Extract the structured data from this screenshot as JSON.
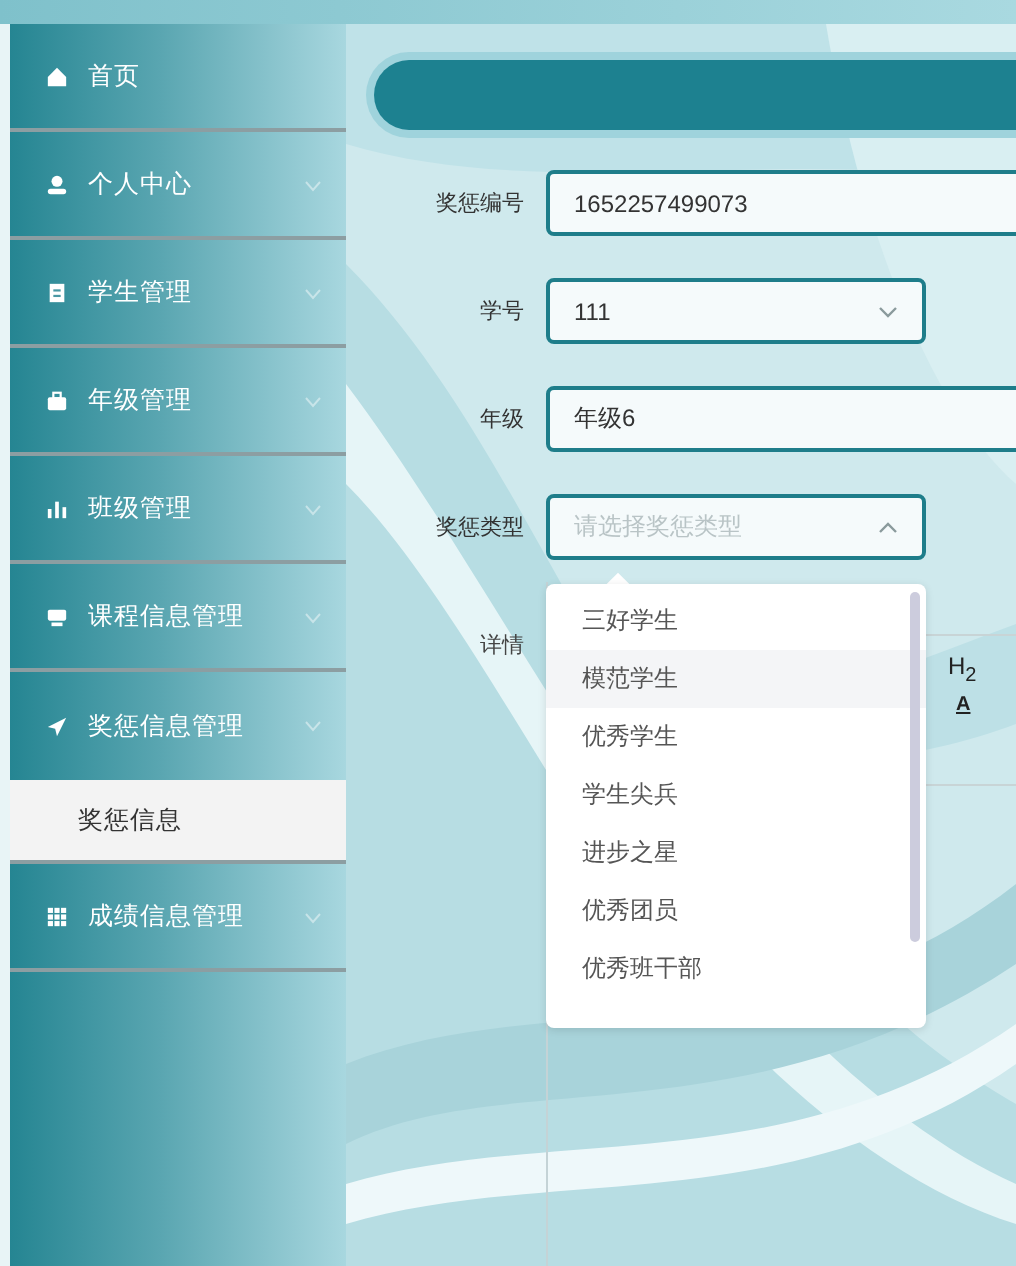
{
  "sidebar": {
    "items": [
      {
        "label": "首页"
      },
      {
        "label": "个人中心",
        "expanded": false
      },
      {
        "label": "学生管理",
        "expanded": false
      },
      {
        "label": "年级管理",
        "expanded": false
      },
      {
        "label": "班级管理",
        "expanded": false
      },
      {
        "label": "课程信息管理",
        "expanded": false
      },
      {
        "label": "奖惩信息管理",
        "expanded": true,
        "children": [
          {
            "label": "奖惩信息",
            "selected": true
          }
        ]
      },
      {
        "label": "成绩信息管理",
        "expanded": false
      }
    ]
  },
  "form": {
    "fields": [
      {
        "kind": "text",
        "label": "奖惩编号",
        "value": "1652257499073"
      },
      {
        "kind": "select",
        "label": "学号",
        "value": "111",
        "open": false
      },
      {
        "kind": "text",
        "label": "年级",
        "value": "年级6"
      },
      {
        "kind": "select",
        "label": "奖惩类型",
        "placeholder": "请选择奖惩类型",
        "open": true,
        "options": [
          {
            "label": "三好学生",
            "highlighted": false
          },
          {
            "label": "模范学生",
            "highlighted": true
          },
          {
            "label": "优秀学生",
            "highlighted": false
          },
          {
            "label": "学生尖兵",
            "highlighted": false
          },
          {
            "label": "进步之星",
            "highlighted": false
          },
          {
            "label": "优秀团员",
            "highlighted": false
          },
          {
            "label": "优秀班干部",
            "highlighted": false
          }
        ]
      }
    ],
    "editor": {
      "label": "详情",
      "toolbar": [
        "H$_{2}$",
        "A"
      ]
    }
  }
}
